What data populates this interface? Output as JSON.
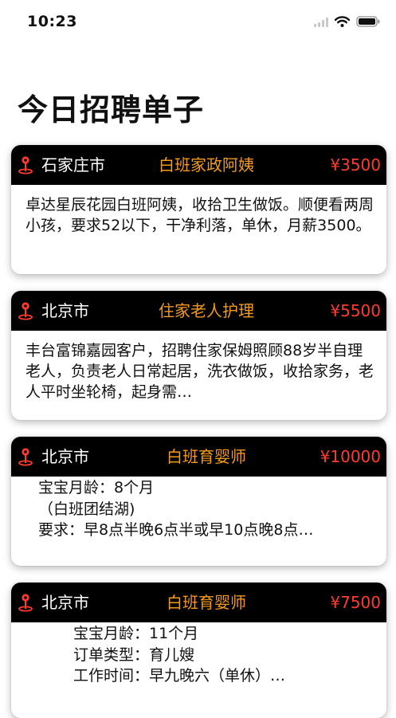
{
  "status_bar": {
    "time": "10:23",
    "icons": [
      "signal-icon",
      "wifi-icon",
      "battery-icon"
    ]
  },
  "page": {
    "title": "今日招聘单子"
  },
  "colors": {
    "header_bg": "#000000",
    "role": "#f39a1c",
    "salary": "#ff3b30",
    "pin": "#ff3b30"
  },
  "cards": [
    {
      "city": "石家庄市",
      "role": "白班家政阿姨",
      "salary": "¥3500",
      "description": "卓达星辰花园白班阿姨，收拾卫生做饭。顺便看两周小孩，要求52以下，干净利落，单休，月薪3500。"
    },
    {
      "city": "北京市",
      "role": "住家老人护理",
      "salary": "¥5500",
      "description": "丰台富锦嘉园客户，招聘住家保姆照顾88岁半自理老人，负责老人日常起居，洗衣做饭，收拾家务，老人平时坐轮椅，起身需…"
    },
    {
      "city": "北京市",
      "role": "白班育婴师",
      "salary": "¥10000",
      "lines": [
        "宝宝月龄：8个月",
        "（白班团结湖)",
        "要求：早8点半晚6点半或早10点晚8点…"
      ]
    },
    {
      "city": "北京市",
      "role": "白班育婴师",
      "salary": "¥7500",
      "lines": [
        "宝宝月龄：11个月",
        "订单类型：育儿嫂",
        "工作时间：早九晚六（单休）…"
      ]
    }
  ]
}
